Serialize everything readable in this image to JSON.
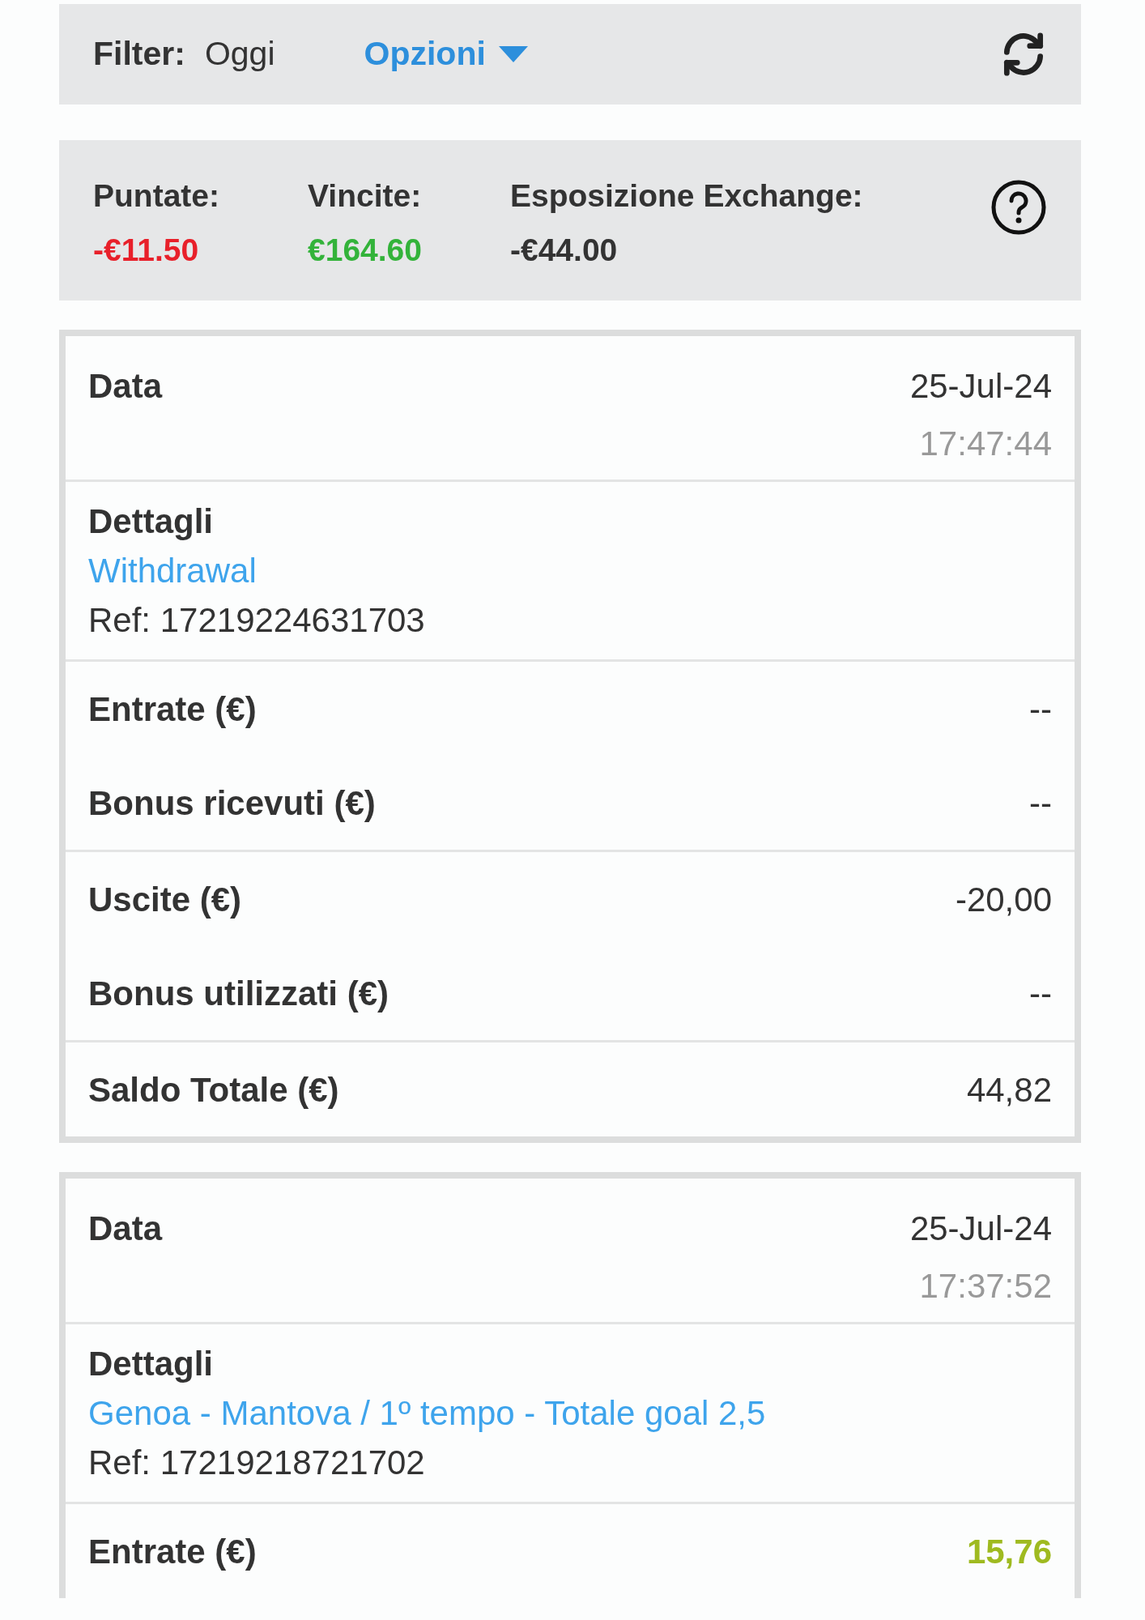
{
  "filter": {
    "label": "Filter:",
    "value": "Oggi",
    "options": "Opzioni"
  },
  "summary": [
    {
      "label": "Puntate:",
      "value": "-€11.50",
      "color": "#e8202a"
    },
    {
      "label": "Vincite:",
      "value": "€164.60",
      "color": "#33b33a"
    },
    {
      "label": "Esposizione Exchange:",
      "value": "-€44.00",
      "color": "#333333"
    }
  ],
  "transactions": [
    {
      "date_label": "Data",
      "date": "25-Jul-24",
      "time": "17:47:44",
      "details_label": "Dettagli",
      "details_link": "Withdrawal",
      "ref": "Ref: 17219224631703",
      "groups": [
        [
          {
            "label": "Entrate (€)",
            "value": "--",
            "color": "#333333"
          },
          {
            "label": "Bonus ricevuti (€)",
            "value": "--",
            "color": "#333333"
          }
        ],
        [
          {
            "label": "Uscite (€)",
            "value": "-20,00",
            "color": "#333333"
          },
          {
            "label": "Bonus utilizzati (€)",
            "value": "--",
            "color": "#333333"
          }
        ],
        [
          {
            "label": "Saldo Totale (€)",
            "value": "44,82",
            "color": "#333333"
          }
        ]
      ]
    },
    {
      "date_label": "Data",
      "date": "25-Jul-24",
      "time": "17:37:52",
      "details_label": "Dettagli",
      "details_link": "Genoa - Mantova / 1º tempo - Totale goal 2,5",
      "ref": "Ref: 17219218721702",
      "groups": [
        [
          {
            "label": "Entrate (€)",
            "value": "15,76",
            "color": "#9fba20"
          }
        ]
      ]
    }
  ]
}
